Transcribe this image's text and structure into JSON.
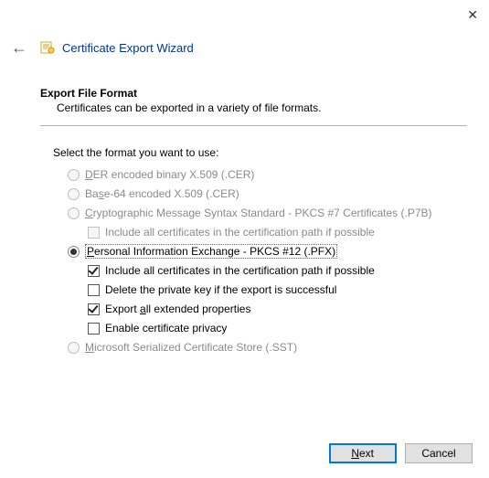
{
  "window": {
    "title": "Certificate Export Wizard"
  },
  "section": {
    "heading": "Export File Format",
    "desc": "Certificates can be exported in a variety of file formats."
  },
  "prompt": "Select the format you want to use:",
  "options": {
    "der": "ER encoded binary X.509 (.CER)",
    "b64": "Ba",
    "b64_rest": "e-64 encoded X.509 (.CER)",
    "p7b": "ryptographic Message Syntax Standard - PKCS #7 Certificates (.P7B)",
    "p7b_sub": "Include all certificates in the certification path if possible",
    "pfx": "ersonal Information Exchange - PKCS #12 (.PFX)",
    "pfx_sub1": "Include all certificates in the certification path if possible",
    "pfx_sub2": "Delete the private key if the export is successful",
    "pfx_sub3": "Export ",
    "pfx_sub3_rest": "ll extended properties",
    "pfx_sub4": "Enable certificate privacy",
    "sst": "icrosoft Serialized Certificate Store (.SST)"
  },
  "buttons": {
    "next": "ext",
    "cancel": "Cancel"
  }
}
